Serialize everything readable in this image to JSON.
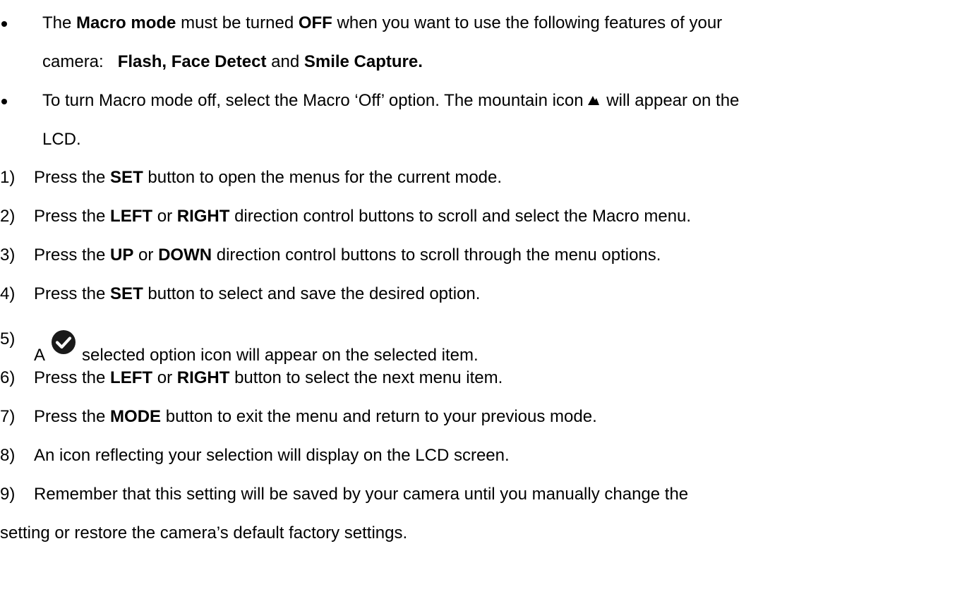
{
  "bullets": [
    {
      "line1": {
        "t1": "The ",
        "b1": "Macro mode",
        "t2": " must be turned ",
        "b2": "OFF",
        "t3": " when you want to use the following features of your"
      },
      "line2": {
        "t1": "camera:   ",
        "b1": "Flash, Face Detect",
        "t2": " and ",
        "b2": "Smile Capture."
      }
    },
    {
      "line1": {
        "t1": "To turn Macro mode off, select the Macro ‘Off’ option. The mountain icon",
        "icon": "mountain-icon",
        "t2": " will appear on the"
      },
      "line2": {
        "t1": "LCD."
      }
    }
  ],
  "steps": [
    {
      "num": "1)",
      "t1": "Press the ",
      "b1": "SET",
      "t2": " button to open the menus for the current mode."
    },
    {
      "num": "2)",
      "t1": "Press the ",
      "b1": "LEFT",
      "t2": " or ",
      "b2": "RIGHT",
      "t3": " direction control buttons to scroll and select the Macro menu."
    },
    {
      "num": "3)",
      "t1": "Press the ",
      "b1": "UP",
      "t2": " or ",
      "b2": "DOWN",
      "t3": " direction control buttons to scroll through the menu options."
    },
    {
      "num": "4)",
      "t1": "Press the ",
      "b1": "SET",
      "t2": " button to select and save the desired option."
    },
    {
      "num": "5)",
      "t1": "A",
      "icon": "check-circle-icon",
      "t2": "selected option icon will appear on the selected item."
    },
    {
      "num": "6)",
      "t1": "Press the ",
      "b1": "LEFT",
      "t2": " or ",
      "b2": "RIGHT",
      "t3": " button to select the next menu item."
    },
    {
      "num": "7)",
      "t1": "Press the ",
      "b1": "MODE",
      "t2": " button to exit the menu and return to your previous mode."
    },
    {
      "num": "8)",
      "t1": "An icon reflecting your selection will display on the LCD screen."
    },
    {
      "num": "9)",
      "t1": "Remember that this setting will be saved by your camera until you manually change the",
      "cont": "setting or restore the camera’s default factory settings."
    }
  ]
}
